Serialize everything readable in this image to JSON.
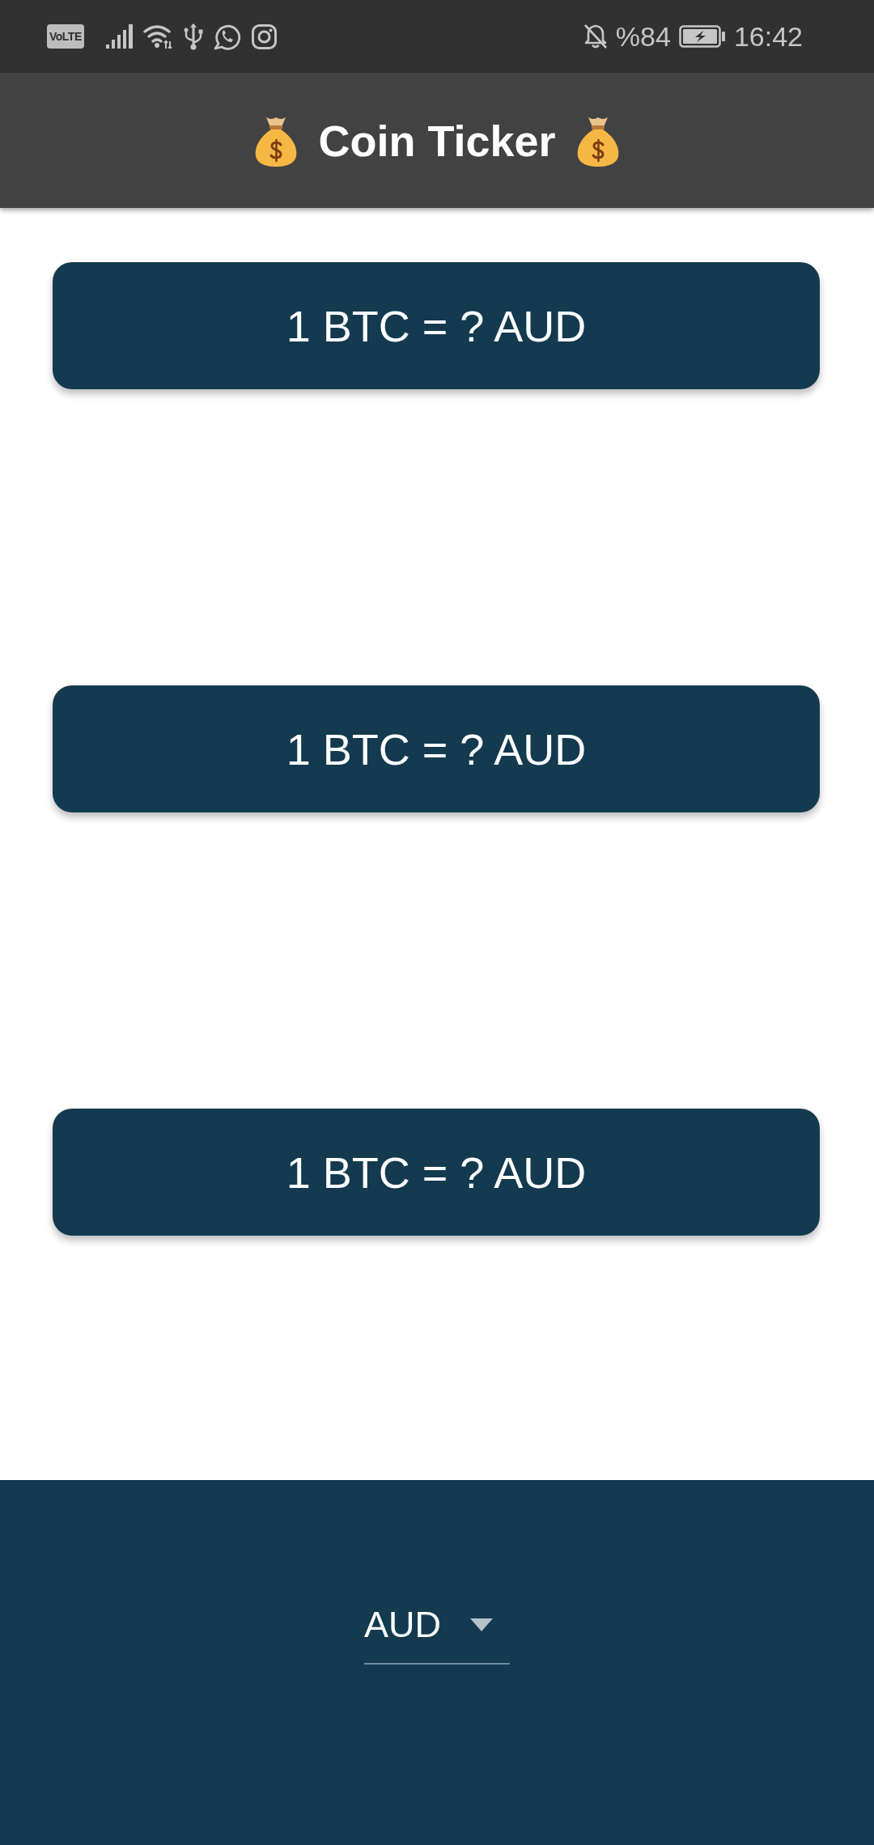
{
  "status_bar": {
    "network_badge": "VoLTE",
    "battery_percent": "%84",
    "time": "16:42"
  },
  "app_bar": {
    "title": "Coin Ticker"
  },
  "rate_cards": [
    {
      "text": "1 BTC = ? AUD"
    },
    {
      "text": "1 BTC = ? AUD"
    },
    {
      "text": "1 BTC = ? AUD"
    }
  ],
  "currency_picker": {
    "value": "AUD"
  }
}
